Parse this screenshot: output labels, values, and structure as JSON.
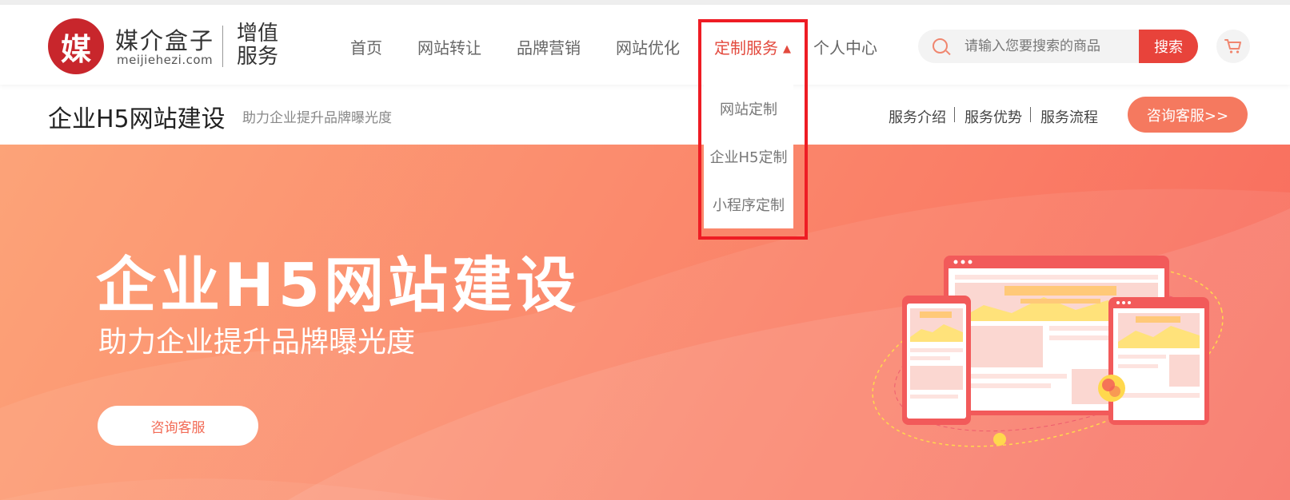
{
  "brand": {
    "logo_char": "媒",
    "name": "媒介盒子",
    "domain": "meijiehezi.com",
    "sub": "增值服务",
    "color": "#c8262c"
  },
  "nav": {
    "items": [
      "首页",
      "网站转让",
      "品牌营销",
      "网站优化",
      "定制服务",
      "个人中心"
    ],
    "active_index": 4,
    "active_color": "#e34a3e",
    "caret": "▲"
  },
  "search": {
    "placeholder": "请输入您要搜索的商品",
    "button": "搜索"
  },
  "cart": {
    "icon": "cart-icon"
  },
  "dropdown": {
    "items": [
      "网站定制",
      "企业H5定制",
      "小程序定制"
    ]
  },
  "subheader": {
    "title": "企业H5网站建设",
    "tagline": "助力企业提升品牌曝光度",
    "links": [
      "服务介绍",
      "服务优势",
      "服务流程"
    ],
    "consult": "咨询客服>>"
  },
  "banner": {
    "title": "企业H5网站建设",
    "subtitle": "助力企业提升品牌曝光度",
    "button": "咨询客服",
    "colors": [
      "#fca378",
      "#f86a5c"
    ]
  }
}
